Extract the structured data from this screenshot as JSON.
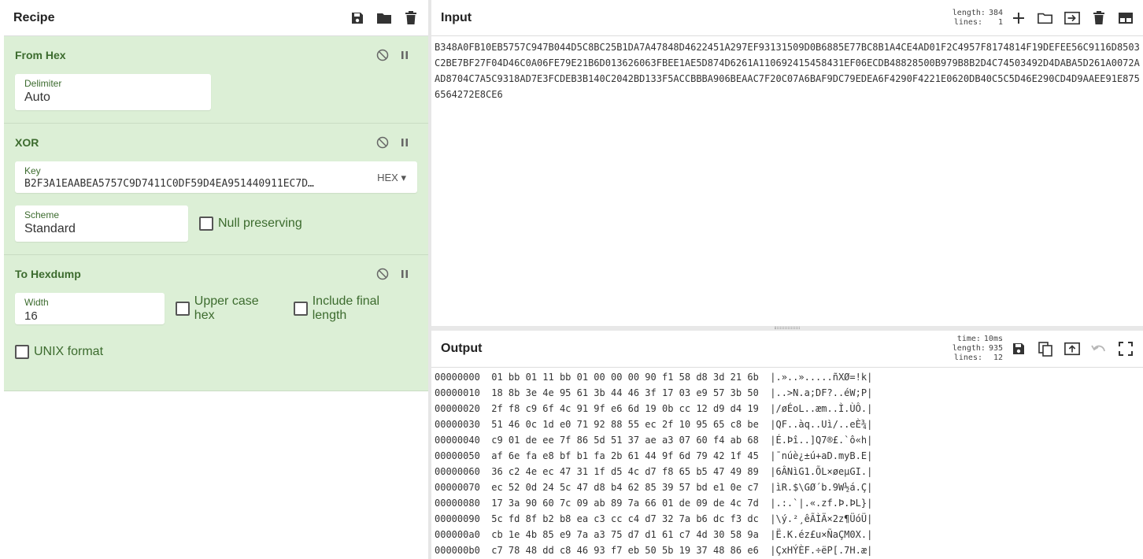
{
  "recipe": {
    "title": "Recipe",
    "operations": [
      {
        "name": "From Hex",
        "fields": [
          {
            "label": "Delimiter",
            "value": "Auto"
          }
        ]
      },
      {
        "name": "XOR",
        "fields": [
          {
            "label": "Key",
            "value": "B2F3A1EAABEA5757C9D7411C0DF59D4EA951440911EC7D…",
            "format": "HEX"
          },
          {
            "label": "Scheme",
            "value": "Standard"
          }
        ],
        "checkboxes": [
          {
            "label": "Null preserving",
            "checked": false
          }
        ]
      },
      {
        "name": "To Hexdump",
        "fields": [
          {
            "label": "Width",
            "value": "16"
          }
        ],
        "checkboxes": [
          {
            "label": "Upper case hex",
            "checked": false
          },
          {
            "label": "Include final length",
            "checked": false
          },
          {
            "label": "UNIX format",
            "checked": false
          }
        ]
      }
    ]
  },
  "input": {
    "title": "Input",
    "stats": {
      "length_label": "length:",
      "length": "384",
      "lines_label": "lines:",
      "lines": "1"
    },
    "text": "B348A0FB10EB5757C947B044D5C8BC25B1DA7A47848D4622451A297EF93131509D0B6885E77BC8B1A4CE4AD01F2C4957F8174814F19DEFEE56C9116D8503C2BE7BF27F04D46C0A06FE79E21B6D013626063FBEE1AE5D874D6261A110692415458431EF06ECDB48828500B979B8B2D4C74503492D4DABA5D261A0072AAD8704C7A5C9318AD7E3FCDEB3B140C2042BD133F5ACCBBBA906BEAAC7F20C07A6BAF9DC79EDEA6F4290F4221E0620DB40C5C5D46E290CD4D9AAEE91E8756564272E8CE6"
  },
  "output": {
    "title": "Output",
    "stats": {
      "time_label": "time:",
      "time": "10ms",
      "length_label": "length:",
      "length": "935",
      "lines_label": "lines:",
      "lines": "12"
    },
    "rows": [
      "00000000  01 bb 01 11 bb 01 00 00 00 90 f1 58 d8 3d 21 6b  |.»..».....ñXØ=!k|",
      "00000010  18 8b 3e 4e 95 61 3b 44 46 3f 17 03 e9 57 3b 50  |..>N.a;DF?..éW;P|",
      "00000020  2f f8 c9 6f 4c 91 9f e6 6d 19 0b cc 12 d9 d4 19  |/øÉoL..æm..Ì.ÙÔ.|",
      "00000030  51 46 0c 1d e0 71 92 88 55 ec 2f 10 95 65 c8 be  |QF..àq..Uì/..eÈ¾|",
      "00000040  c9 01 de ee 7f 86 5d 51 37 ae a3 07 60 f4 ab 68  |É.Þî..]Q7®£.`ô«h|",
      "00000050  af 6e fa e8 bf b1 fa 2b 61 44 9f 6d 79 42 1f 45  |¯núè¿±ú+aD.myB.E|",
      "00000060  36 c2 4e ec 47 31 1f d5 4c d7 f8 65 b5 47 49 89  |6ÂNìG1.ÕL×øeµGI.|",
      "00000070  ec 52 0d 24 5c 47 d8 b4 62 85 39 57 bd e1 0e c7  |ìR.$\\GØ´b.9W½á.Ç|",
      "00000080  17 3a 90 60 7c 09 ab 89 7a 66 01 de 09 de 4c 7d  |.:.`|.«.zf.Þ.ÞL}|",
      "00000090  5c fd 8f b2 b8 ea c3 cc c4 d7 32 7a b6 dc f3 dc  |\\ý.²¸êÃÌÄ×2z¶ÜóÜ|",
      "000000a0  cb 1e 4b 85 e9 7a a3 75 d7 d1 61 c7 4d 30 58 9a  |Ë.K.éz£u×ÑaÇM0X.|",
      "000000b0  c7 78 48 dd c8 46 93 f7 eb 50 5b 19 37 48 86 e6  |ÇxHÝÈF.÷ëP[.7H.æ|"
    ]
  }
}
